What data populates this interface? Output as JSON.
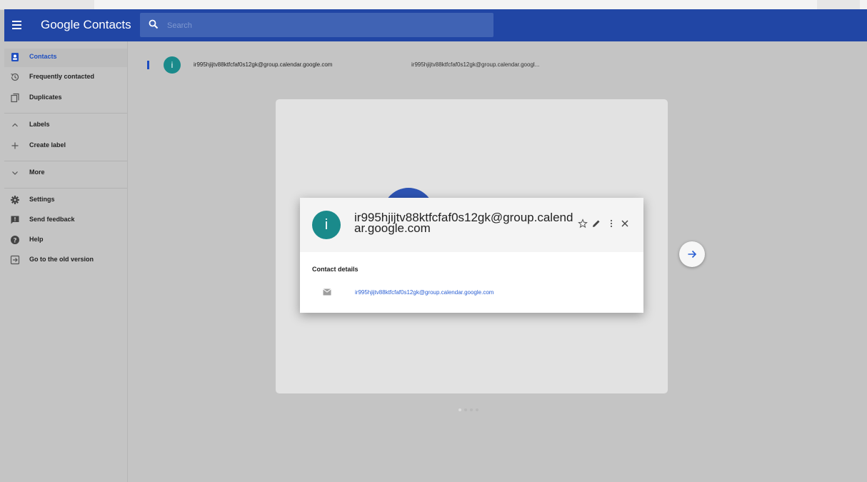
{
  "colors": {
    "appbar": "#2146a5",
    "accent": "#1f4fc0",
    "avatar": "#1a8a8b"
  },
  "header": {
    "brand": "Google Contacts",
    "search_placeholder": "Search"
  },
  "sidebar": {
    "items": [
      {
        "label": "Contacts",
        "icon": "contacts-icon",
        "active": true
      },
      {
        "label": "Frequently contacted",
        "icon": "history-icon"
      },
      {
        "label": "Duplicates",
        "icon": "duplicates-icon"
      },
      {
        "label": "Labels",
        "icon": "chevron-up-icon"
      },
      {
        "label": "Create label",
        "icon": "plus-icon"
      },
      {
        "label": "More",
        "icon": "chevron-down-icon"
      },
      {
        "label": "Settings",
        "icon": "gear-icon"
      },
      {
        "label": "Send feedback",
        "icon": "feedback-icon"
      },
      {
        "label": "Help",
        "icon": "help-icon"
      },
      {
        "label": "Go to the old version",
        "icon": "exit-icon"
      }
    ]
  },
  "contact_row": {
    "avatar_letter": "i",
    "name": "ir995hjijtv88ktfcfaf0s12gk@group.calendar.google.com",
    "email": "ir995hjijtv88ktfcfaf0s12gk@group.calendar.googl..."
  },
  "dialog": {
    "avatar_letter": "i",
    "title": "ir995hjijtv88ktfcfaf0s12gk@group.calendar.google.com",
    "section_title": "Contact details",
    "email": "ir995hjijtv88ktfcfaf0s12gk@group.calendar.google.com",
    "actions": [
      "star-icon",
      "edit-icon",
      "more-vert-icon",
      "close-icon"
    ]
  },
  "pager": {
    "count": 4,
    "active": 1
  }
}
